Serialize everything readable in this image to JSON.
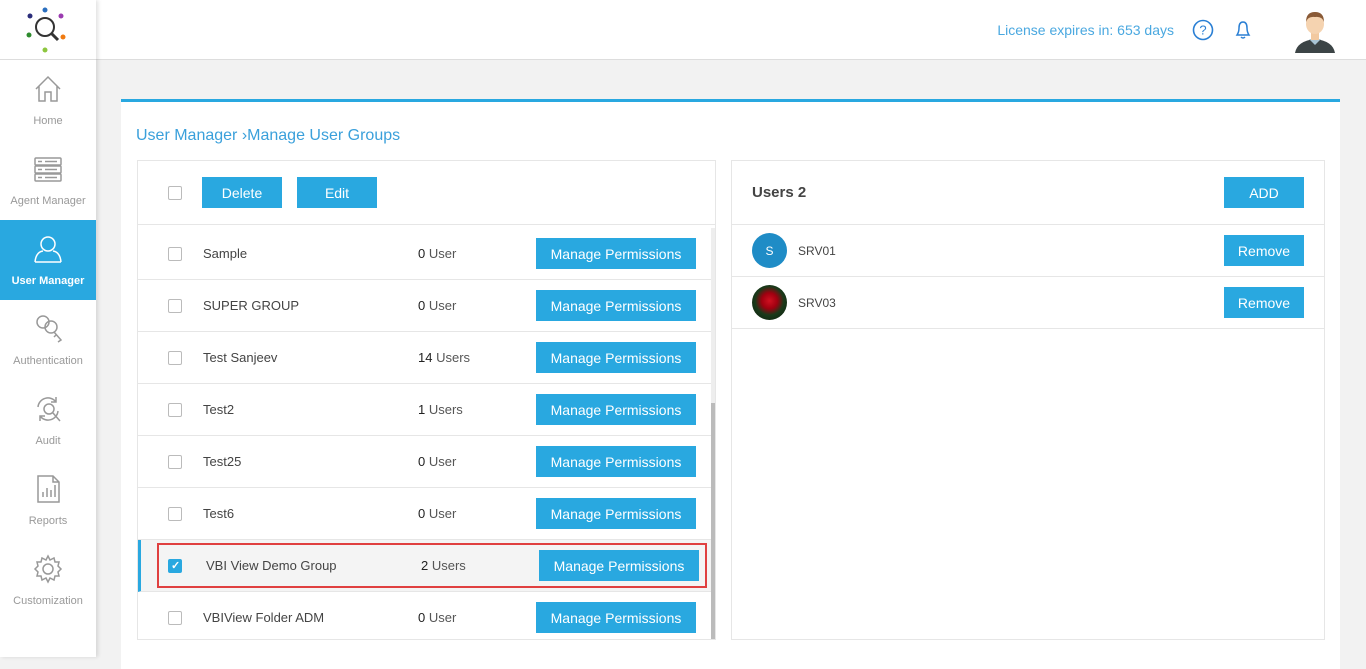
{
  "sidebar": {
    "items": [
      {
        "label": "Home",
        "icon": "home-icon"
      },
      {
        "label": "Agent Manager",
        "icon": "server-icon"
      },
      {
        "label": "User Manager",
        "icon": "user-icon",
        "active": true
      },
      {
        "label": "Authentication",
        "icon": "keys-icon"
      },
      {
        "label": "Audit",
        "icon": "audit-icon"
      },
      {
        "label": "Reports",
        "icon": "report-icon"
      },
      {
        "label": "Customization",
        "icon": "gear-icon"
      }
    ]
  },
  "header": {
    "license_prefix": "License expires in: ",
    "license_days": "653",
    "license_suffix": " days"
  },
  "breadcrumb": {
    "root": "User Manager",
    "sep": "›",
    "current": "Manage User Groups"
  },
  "groups": {
    "delete_label": "Delete",
    "edit_label": "Edit",
    "manage_label": "Manage Permissions",
    "rows": [
      {
        "name": "Sample",
        "count": "0",
        "unit": "User",
        "checked": false
      },
      {
        "name": "SUPER GROUP",
        "count": "0",
        "unit": "User",
        "checked": false
      },
      {
        "name": "Test Sanjeev",
        "count": "14",
        "unit": "Users",
        "checked": false
      },
      {
        "name": "Test2",
        "count": "1",
        "unit": "Users",
        "checked": false
      },
      {
        "name": "Test25",
        "count": "0",
        "unit": "User",
        "checked": false
      },
      {
        "name": "Test6",
        "count": "0",
        "unit": "User",
        "checked": false
      },
      {
        "name": "VBI View Demo Group",
        "count": "2",
        "unit": "Users",
        "checked": true
      },
      {
        "name": "VBIView Folder ADM",
        "count": "0",
        "unit": "User",
        "checked": false
      }
    ]
  },
  "users": {
    "title": "Users 2",
    "add_label": "ADD",
    "remove_label": "Remove",
    "items": [
      {
        "name": "SRV01",
        "avatar": "S"
      },
      {
        "name": "SRV03",
        "avatar": ""
      }
    ]
  },
  "colors": {
    "accent": "#29a8e0",
    "highlight": "#e04040"
  }
}
